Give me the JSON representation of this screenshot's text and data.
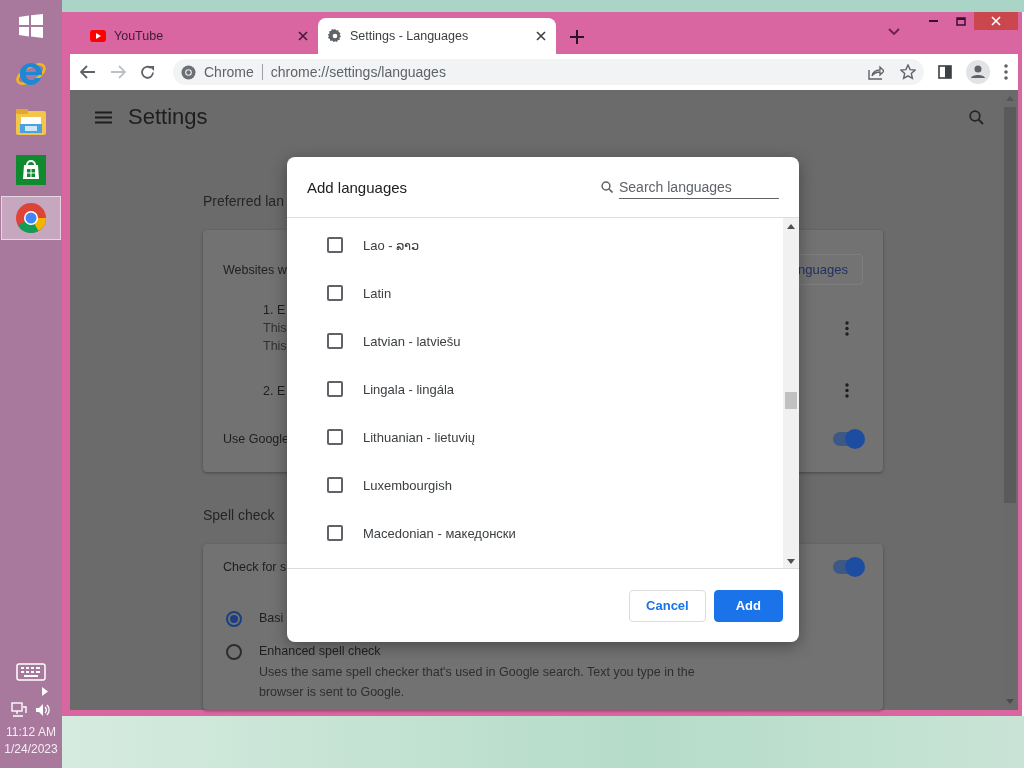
{
  "taskbar": {
    "apps": [
      {
        "kind": "start",
        "selected": false
      },
      {
        "kind": "e-browser",
        "selected": false
      },
      {
        "kind": "files",
        "selected": false
      },
      {
        "kind": "store",
        "selected": false
      },
      {
        "kind": "browser",
        "selected": true
      }
    ],
    "clock": {
      "time": "11:12 AM",
      "date": "1/24/2023"
    }
  },
  "browser": {
    "tabs": [
      {
        "kind": "video",
        "title": "YouTube",
        "selected": false
      },
      {
        "kind": "settings",
        "title": "Settings - Languages",
        "selected": true
      }
    ],
    "omnibox": {
      "site_chip": "Chrome",
      "url": "chrome://settings/languages"
    }
  },
  "settings": {
    "title": "Settings",
    "preferred_languages": {
      "heading": "Preferred lan",
      "subheading": "Websites w",
      "add_button": "nguages",
      "languages": [
        {
          "label": "1. E",
          "lines": [
            "This",
            "This"
          ]
        },
        {
          "label": "2. E"
        }
      ],
      "translate": {
        "label": "Use Google",
        "on": true
      }
    },
    "spell_check": {
      "heading": "Spell check",
      "toggle": {
        "label": "Check for s",
        "on": true
      },
      "options": [
        {
          "label": "Basi",
          "selected": true
        },
        {
          "label": "Enhanced spell check",
          "description": "Uses the same spell checker that's used in Google search. Text you type in the browser is sent to Google.",
          "selected": false
        }
      ]
    }
  },
  "dialog": {
    "title": "Add languages",
    "search": {
      "placeholder": "Search languages"
    },
    "languages": [
      {
        "name": "Lao - ລາວ",
        "checked": false
      },
      {
        "name": "Latin",
        "checked": false
      },
      {
        "name": "Latvian - latviešu",
        "checked": false
      },
      {
        "name": "Lingala - lingála",
        "checked": false
      },
      {
        "name": "Lithuanian - lietuvių",
        "checked": false
      },
      {
        "name": "Luxembourgish",
        "checked": false
      },
      {
        "name": "Macedonian - македонски",
        "checked": false
      }
    ],
    "buttons": [
      {
        "label": "Cancel",
        "kind": "secondary"
      },
      {
        "label": "Add",
        "kind": "primary"
      }
    ]
  }
}
